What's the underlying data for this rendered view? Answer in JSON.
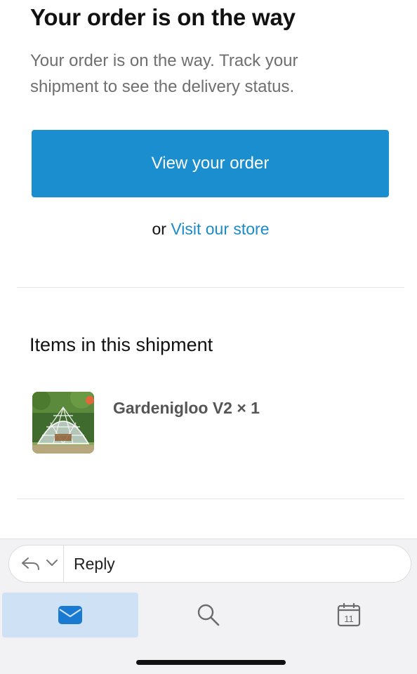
{
  "email": {
    "title": "Your order is on the way",
    "subtitle_line1": "Your order is on the way. Track your",
    "subtitle_line2": "shipment to see the delivery status.",
    "primary_button": "View your order",
    "alt_prefix": "or",
    "alt_link": "Visit our store",
    "items_heading": "Items in this shipment",
    "items": [
      {
        "name": "Gardenigloo V2 × 1",
        "image": "garden-dome-photo"
      }
    ]
  },
  "reply_bar": {
    "label": "Reply",
    "icons": [
      "reply-arrow-icon",
      "chevron-down-icon"
    ]
  },
  "tab_bar": {
    "tabs": [
      {
        "icon": "mail-icon",
        "selected": true
      },
      {
        "icon": "search-icon",
        "selected": false
      },
      {
        "icon": "calendar-icon",
        "day": "11",
        "selected": false
      }
    ]
  },
  "colors": {
    "accent": "#1a8ece",
    "link": "#1d8ac8",
    "selected_tab_bg": "#cfe1f4",
    "mail_icon": "#1a79d1"
  }
}
